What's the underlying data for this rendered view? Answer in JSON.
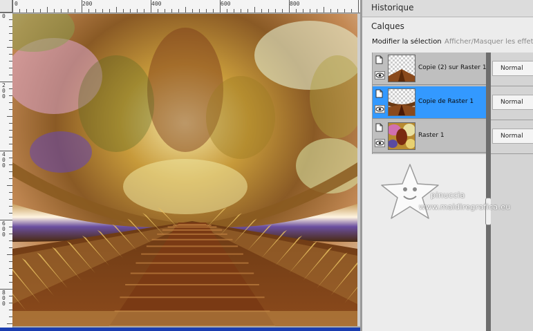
{
  "rulers": {
    "top_labels": [
      "0",
      "200",
      "400",
      "600",
      "800"
    ],
    "left_labels": [
      "0",
      "200",
      "400",
      "600",
      "800"
    ]
  },
  "panel": {
    "history_title": "Historique",
    "layers_title": "Calques",
    "toolbar": {
      "modify_selection": "Modifier la sélection",
      "toggle_effects": "Afficher/Masquer les effets"
    },
    "layers": [
      {
        "name": "Copie (2) sur Raster 1",
        "blend": "Normal",
        "selected": false
      },
      {
        "name": "Copie de Raster 1",
        "blend": "Normal",
        "selected": true
      },
      {
        "name": "Raster 1",
        "blend": "Normal",
        "selected": false
      }
    ]
  },
  "icons": {
    "visibility_page": "page-icon",
    "visibility_eye": "eye-icon",
    "watermark": "star-mascot-icon"
  },
  "watermark": {
    "name": "pinuccia",
    "url": "www.maidiregrafica.eu"
  },
  "colors": {
    "selection": "#3399ff",
    "canvas_bottom_bar": "#1a3db0"
  }
}
